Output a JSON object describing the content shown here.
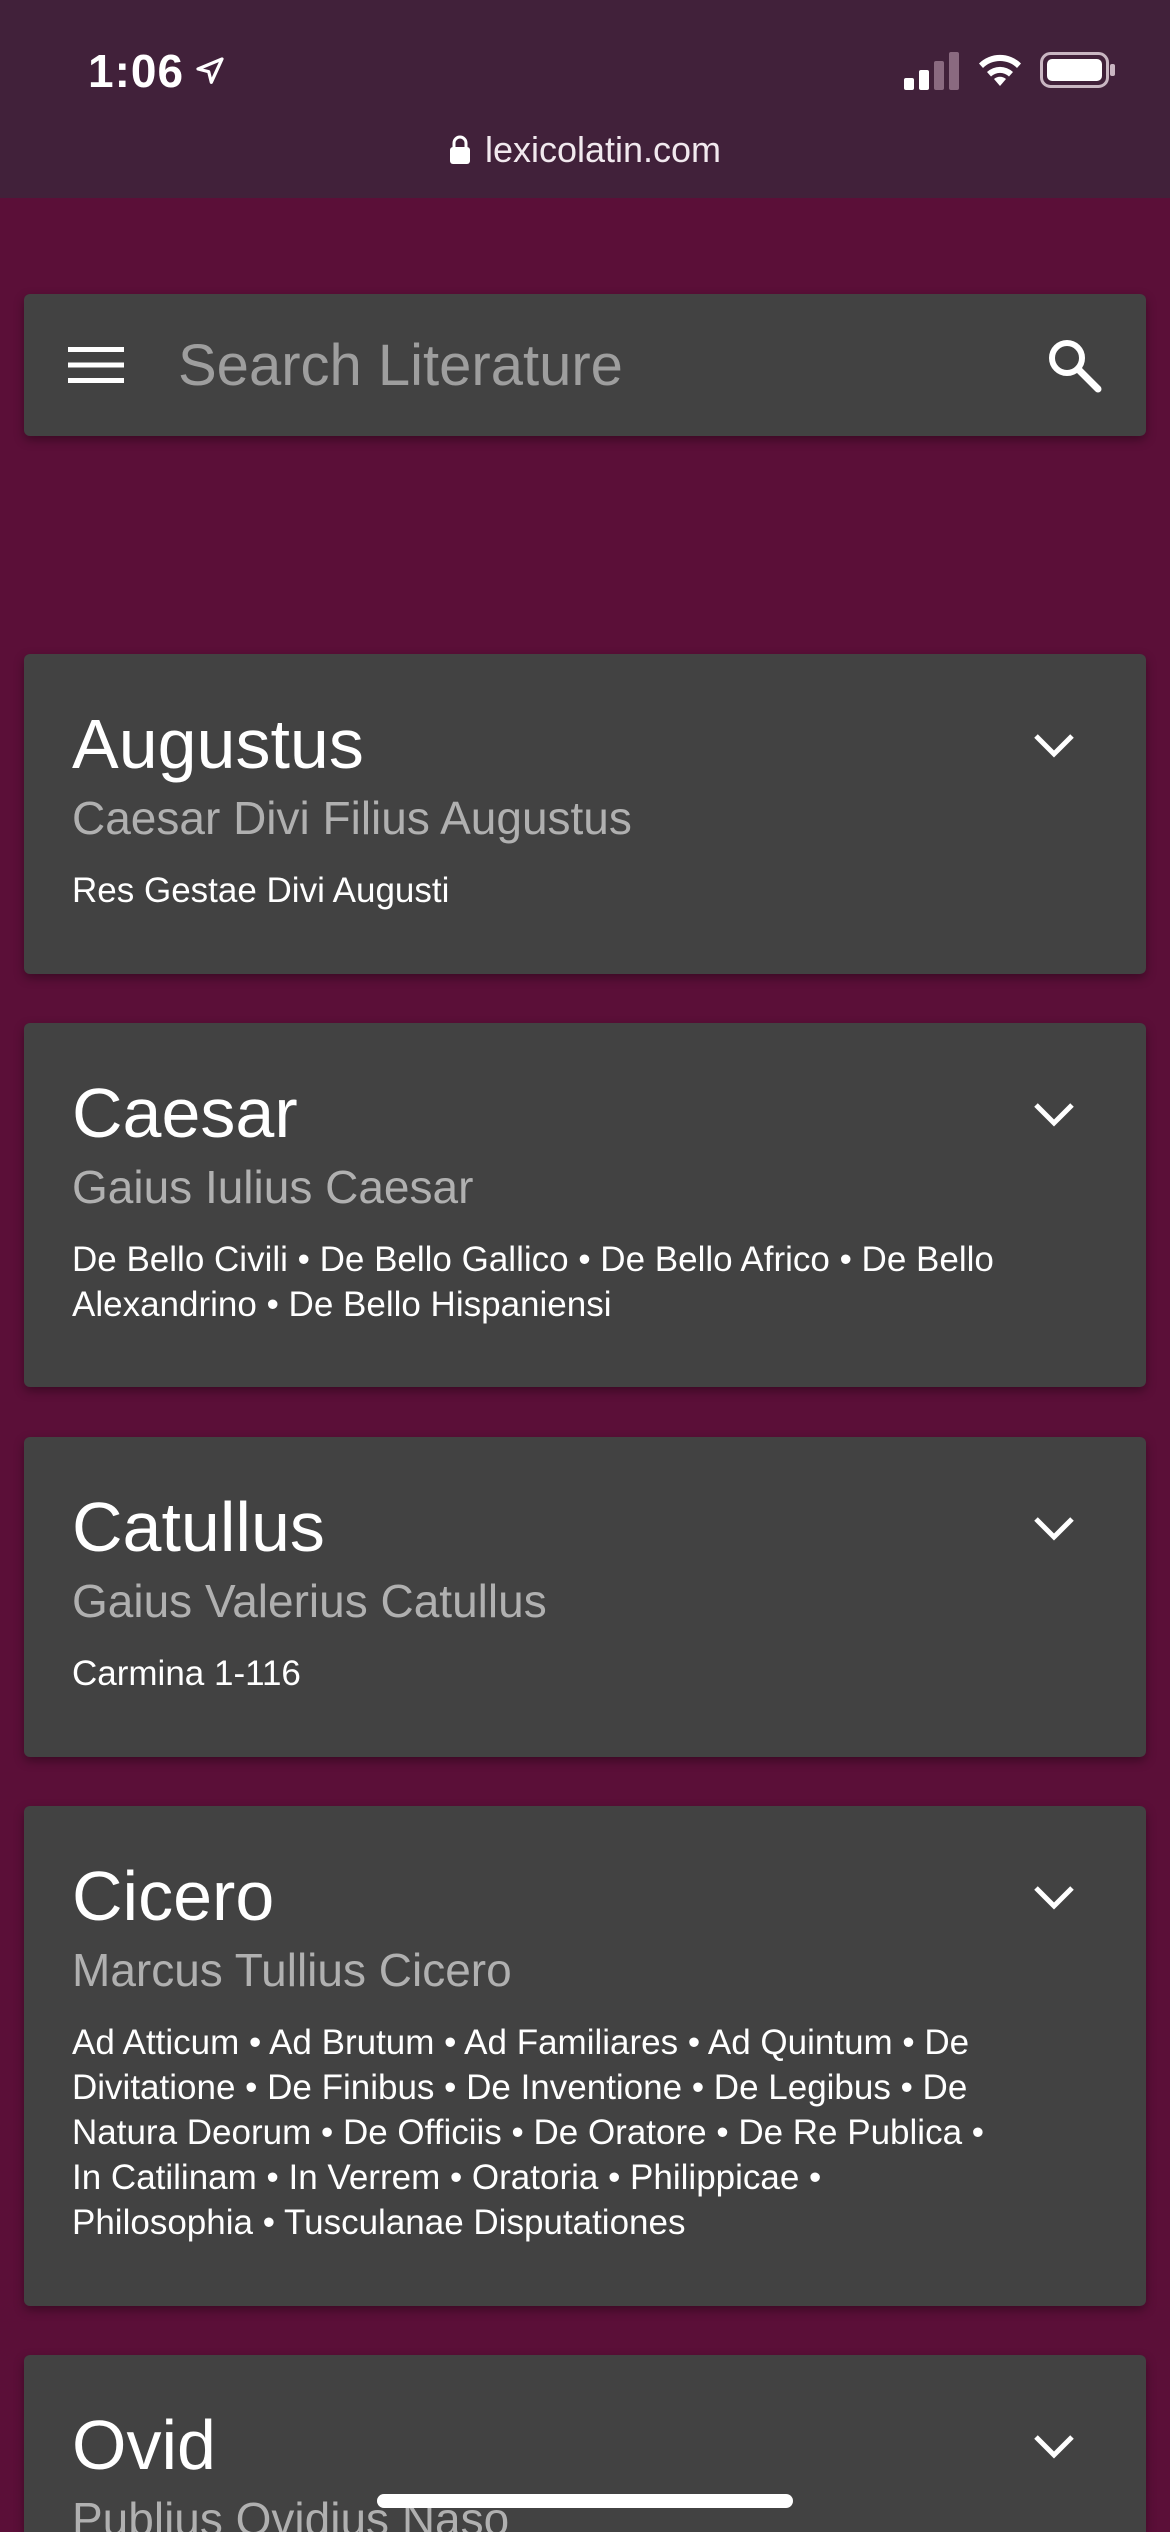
{
  "status_bar": {
    "time": "1:06",
    "url": "lexicolatin.com",
    "icons": [
      "location-arrow-icon",
      "cellular-signal-icon",
      "wifi-icon",
      "battery-icon",
      "lock-icon"
    ]
  },
  "search": {
    "placeholder": "Search Literature",
    "value": "",
    "icons": [
      "menu-icon",
      "search-icon"
    ]
  },
  "authors": [
    {
      "name": "Augustus",
      "full_name": "Caesar Divi Filius Augustus",
      "works": "Res Gestae Divi Augusti"
    },
    {
      "name": "Caesar",
      "full_name": "Gaius Iulius Caesar",
      "works": "De Bello Civili • De Bello Gallico • De Bello Africo • De Bello Alexandrino • De Bello Hispaniensi"
    },
    {
      "name": "Catullus",
      "full_name": "Gaius Valerius Catullus",
      "works": "Carmina 1-116"
    },
    {
      "name": "Cicero",
      "full_name": "Marcus Tullius Cicero",
      "works": "Ad Atticum • Ad Brutum • Ad Familiares • Ad Quintum • De Divitatione • De Finibus • De Inventione • De Legibus • De Natura Deorum • De Officiis • De Oratore • De Re Publica • In Catilinam • In Verrem • Oratoria • Philippicae • Philosophia • Tusculanae Disputationes"
    },
    {
      "name": "Ovid",
      "full_name": "Publius Ovidius Naso",
      "works": ""
    }
  ],
  "colors": {
    "page_background": "#5b0f38",
    "status_bar_background": "#41213a",
    "card_background": "#424242",
    "subtitle_text": "#b0b0b0",
    "placeholder_text": "#9e9e9e"
  }
}
